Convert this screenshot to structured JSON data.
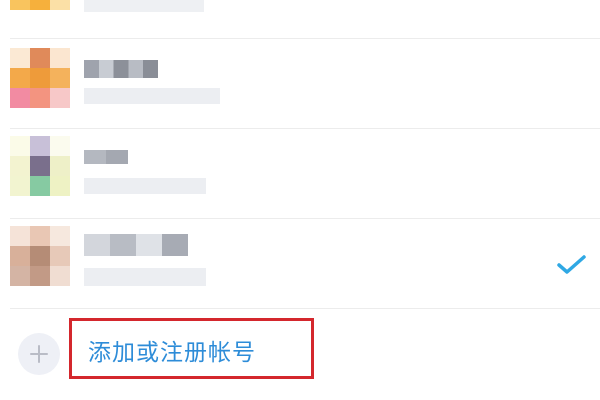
{
  "account_list": {
    "add_account_label": "添加或注册帐号",
    "selected_account_index": 3
  },
  "colors": {
    "accent": "#2d8cd8",
    "check": "#2fa8e4",
    "highlight_border": "#d4272d"
  },
  "icons": {
    "add": "plus-icon",
    "selected": "checkmark-icon"
  }
}
